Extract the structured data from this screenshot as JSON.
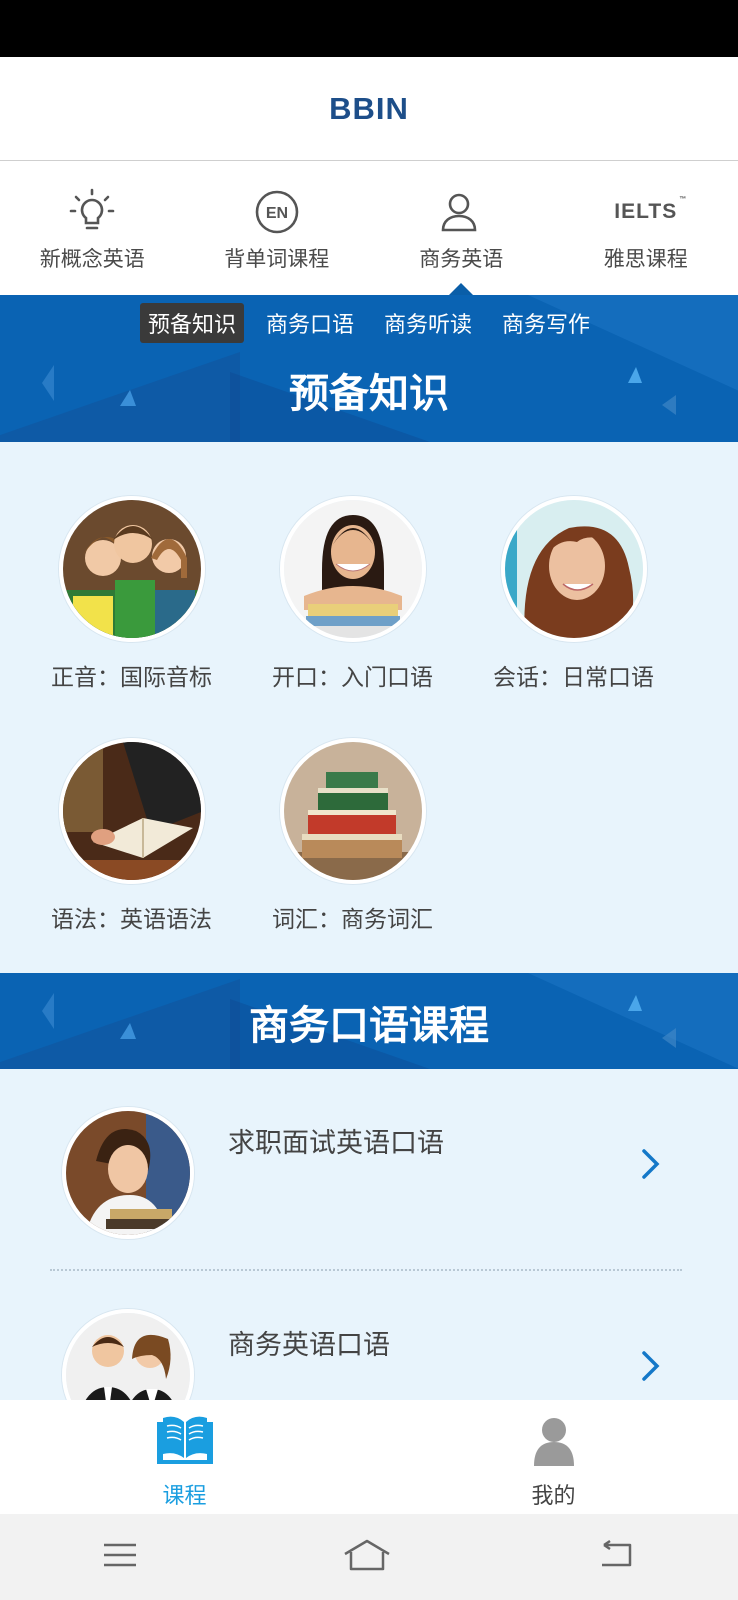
{
  "app": {
    "title": "BBIN"
  },
  "categories": [
    {
      "label": "新概念英语",
      "icon": "lightbulb-icon"
    },
    {
      "label": "背单词课程",
      "icon": "en-circle-icon"
    },
    {
      "label": "商务英语",
      "icon": "user-icon",
      "active": true
    },
    {
      "label": "雅思课程",
      "icon": "ielts-logo-icon",
      "logo_text": "IELTS",
      "logo_mark": "™"
    }
  ],
  "sub_tabs": [
    {
      "label": "预备知识",
      "active": true
    },
    {
      "label": "商务口语"
    },
    {
      "label": "商务听读"
    },
    {
      "label": "商务写作"
    }
  ],
  "section1": {
    "title": "预备知识",
    "items": [
      {
        "label": "正音：国际音标",
        "image": "students-group-photo"
      },
      {
        "label": "开口：入门口语",
        "image": "girl-with-books-photo"
      },
      {
        "label": "会话：日常口语",
        "image": "smiling-woman-photo"
      },
      {
        "label": "语法：英语语法",
        "image": "reading-book-photo"
      },
      {
        "label": "词汇：商务词汇",
        "image": "book-stack-photo"
      }
    ]
  },
  "section2": {
    "title": "商务口语课程",
    "courses": [
      {
        "title": "求职面试英语口语",
        "image": "woman-reading-photo"
      },
      {
        "title": "商务英语口语",
        "image": "business-couple-photo"
      }
    ]
  },
  "bottom_nav": [
    {
      "label": "课程",
      "icon": "open-book-icon",
      "active": true
    },
    {
      "label": "我的",
      "icon": "person-icon"
    }
  ],
  "system_nav": [
    "menu-icon",
    "home-icon",
    "back-icon"
  ],
  "colors": {
    "primary": "#0a63b3",
    "accent": "#1a9ee0",
    "header_text": "#1d4e89",
    "bg": "#e8f4fc"
  }
}
